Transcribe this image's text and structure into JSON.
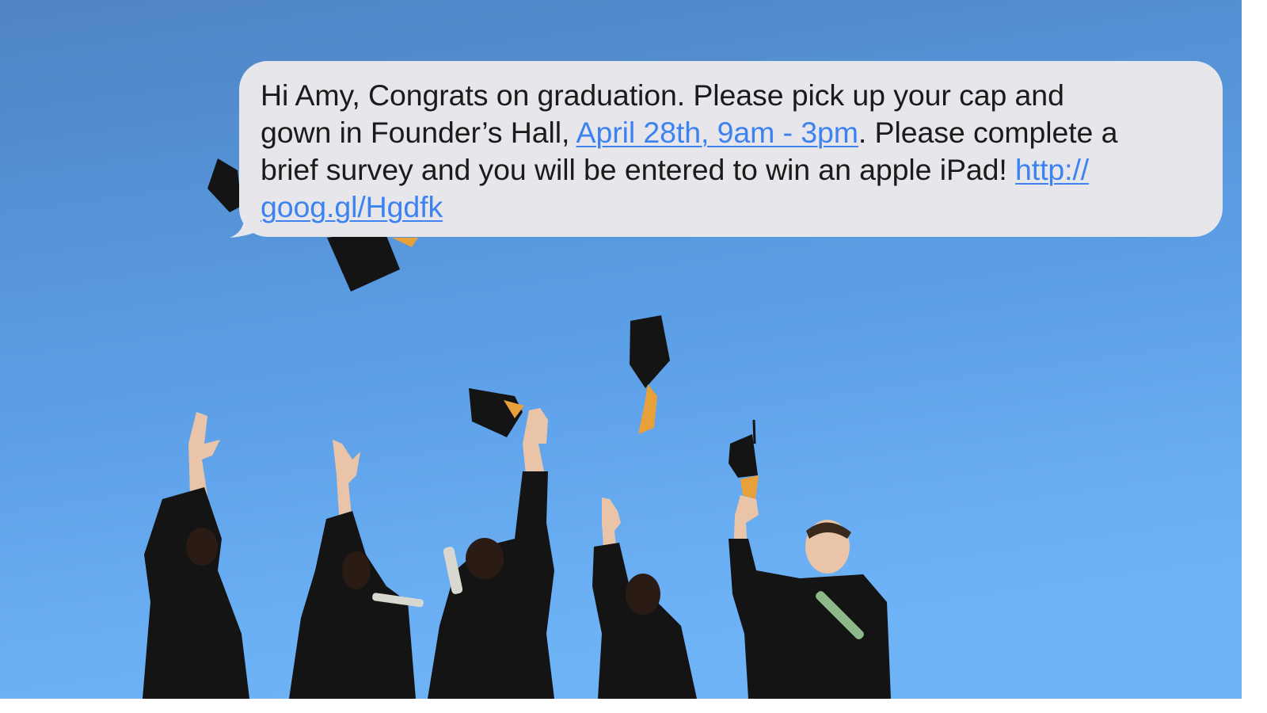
{
  "message": {
    "l1": "Hi Amy, Congrats on graduation. Please pick up your cap and",
    "l2a": "gown in Founder’s Hall, ",
    "link_date": "April 28th, 9am - 3pm",
    "l2b": ". Please complete a",
    "l3a": "brief survey and you will be entered to win an apple iPad! ",
    "link_url_1": "http://",
    "link_url_2": "goog.gl/Hgdfk"
  },
  "colors": {
    "sky_top": "#4f84c3",
    "sky_bottom": "#6fb3f7",
    "bubble": "#e6e6eb",
    "link": "#3d82f1",
    "gown": "#141414",
    "tassel": "#e8a03a"
  },
  "photo": {
    "graduate_count": 5,
    "caps_in_air": 5
  }
}
